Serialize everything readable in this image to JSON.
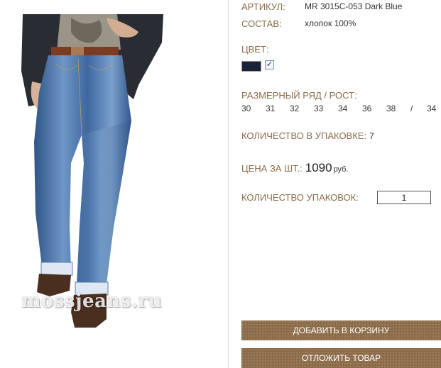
{
  "product": {
    "sku_label": "АРТИКУЛ:",
    "sku_value": "MR 3015C-053 Dark Blue",
    "composition_label": "СОСТАВ:",
    "composition_value": "хлопок 100%",
    "color_label": "ЦВЕТ:",
    "color_swatch": "#1c2238",
    "color_checked": "✓",
    "size_label": "РАЗМЕРНЫЙ РЯД / РОСТ:",
    "sizes": [
      "30",
      "31",
      "32",
      "33",
      "34",
      "36",
      "38",
      "/",
      "34"
    ],
    "pack_qty_label": "КОЛИЧЕСТВО В УПАКОВКЕ:",
    "pack_qty_value": "7",
    "price_label": "ЦЕНА ЗА ШТ.:",
    "price_value": "1090",
    "price_currency": "руб.",
    "packs_label": "КОЛИЧЕСТВО УПАКОВОК:",
    "packs_value": "1"
  },
  "buttons": {
    "add_to_cart": "ДОБАВИТЬ В КОРЗИНУ",
    "defer": "ОТЛОЖИТЬ ТОВАР"
  },
  "image": {
    "watermark": "mossjeans.ru"
  },
  "colors": {
    "label_accent": "#8a6d4a",
    "button_bg": "#8c6b48"
  }
}
